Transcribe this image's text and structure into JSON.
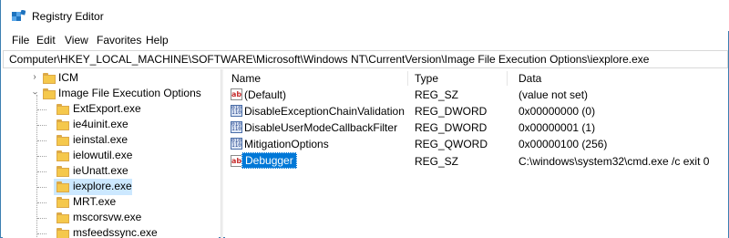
{
  "window": {
    "title": "Registry Editor"
  },
  "menu": {
    "items": [
      "File",
      "Edit",
      "View",
      "Favorites",
      "Help"
    ]
  },
  "address": {
    "path": "Computer\\HKEY_LOCAL_MACHINE\\SOFTWARE\\Microsoft\\Windows NT\\CurrentVersion\\Image File Execution Options\\iexplore.exe"
  },
  "tree": {
    "nodes": [
      {
        "label": "ICM",
        "expander": "collapsed"
      },
      {
        "label": "Image File Execution Options",
        "expander": "expanded"
      },
      {
        "label": "ExtExport.exe"
      },
      {
        "label": "ie4uinit.exe"
      },
      {
        "label": "ieinstal.exe"
      },
      {
        "label": "ielowutil.exe"
      },
      {
        "label": "ieUnatt.exe"
      },
      {
        "label": "iexplore.exe",
        "selected": true
      },
      {
        "label": "MRT.exe"
      },
      {
        "label": "mscorsvw.exe"
      },
      {
        "label": "msfeedssync.exe"
      }
    ]
  },
  "list": {
    "headers": {
      "name": "Name",
      "type": "Type",
      "data": "Data"
    },
    "rows": [
      {
        "name": "(Default)",
        "type": "REG_SZ",
        "data": "(value not set)",
        "icon": "string-value-icon"
      },
      {
        "name": "DisableExceptionChainValidation",
        "type": "REG_DWORD",
        "data": "0x00000000 (0)",
        "icon": "binary-value-icon"
      },
      {
        "name": "DisableUserModeCallbackFilter",
        "type": "REG_DWORD",
        "data": "0x00000001 (1)",
        "icon": "binary-value-icon"
      },
      {
        "name": "MitigationOptions",
        "type": "REG_QWORD",
        "data": "0x00000100 (256)",
        "icon": "binary-value-icon"
      },
      {
        "name": "Debugger",
        "type": "REG_SZ",
        "data": "C:\\windows\\system32\\cmd.exe /c exit 0",
        "icon": "string-value-icon",
        "selected": true
      }
    ]
  },
  "colors": {
    "selection": "#0078d7",
    "tree_selection": "#cce8ff",
    "folder": "#f5c84c"
  }
}
